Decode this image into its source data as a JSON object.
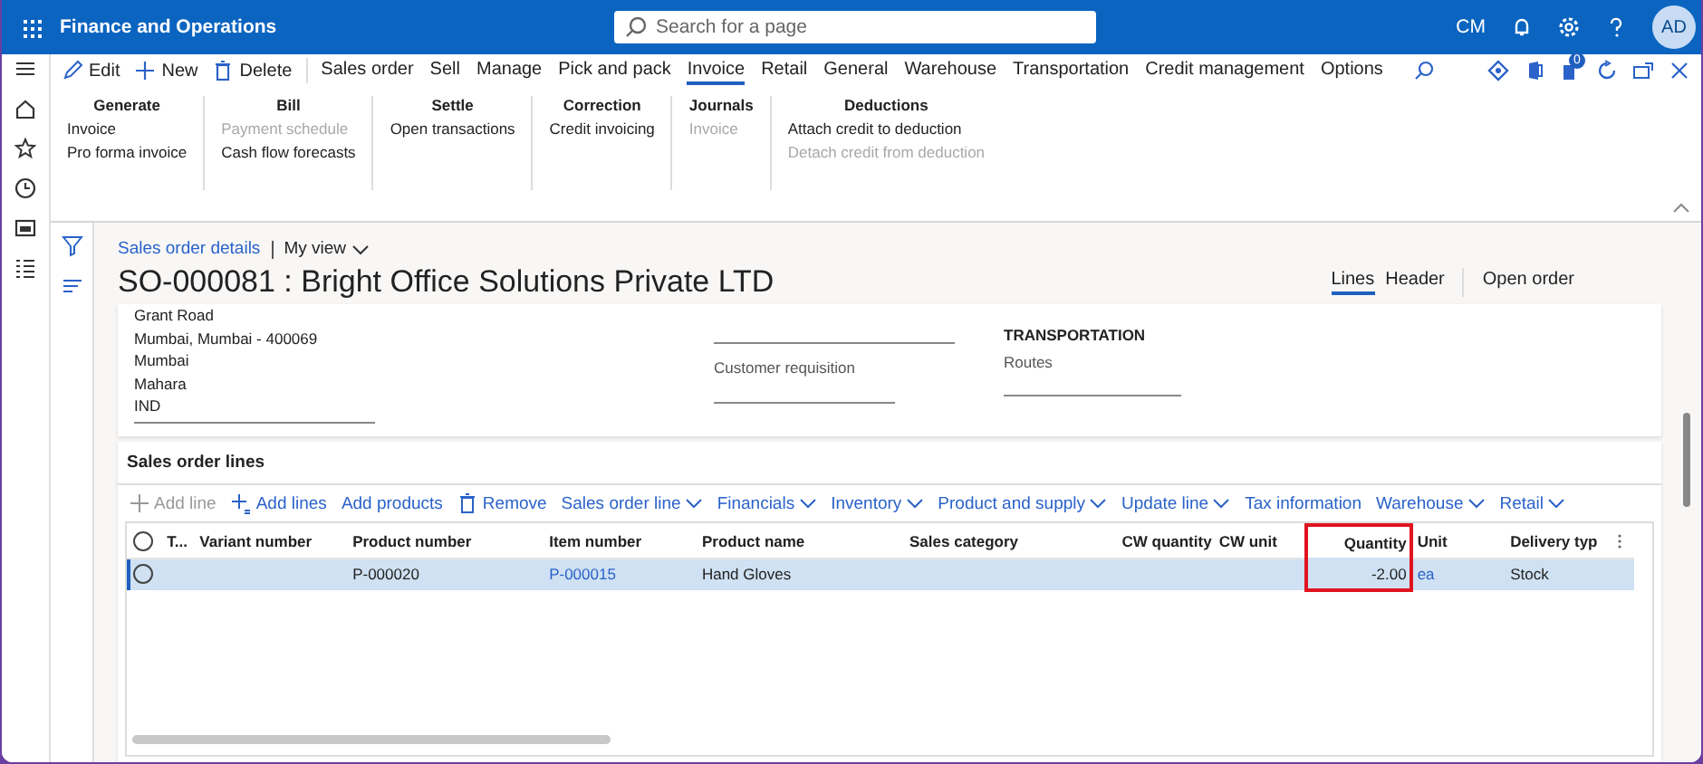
{
  "app_bar": {
    "title": "Finance and Operations",
    "search": {
      "placeholder": "Search for a page"
    },
    "company": "CM",
    "avatar": "AD"
  },
  "action_pane": {
    "buttons": [
      {
        "label": "Edit",
        "kind": "edit"
      },
      {
        "label": "New",
        "kind": "new"
      },
      {
        "label": "Delete",
        "kind": "delete"
      }
    ],
    "tabs": [
      {
        "label": "Sales order",
        "selected": false
      },
      {
        "label": "Sell",
        "selected": false
      },
      {
        "label": "Manage",
        "selected": false
      },
      {
        "label": "Pick and pack",
        "selected": false
      },
      {
        "label": "Invoice",
        "selected": true
      },
      {
        "label": "Retail",
        "selected": false
      },
      {
        "label": "General",
        "selected": false
      },
      {
        "label": "Warehouse",
        "selected": false
      },
      {
        "label": "Transportation",
        "selected": false
      },
      {
        "label": "Credit management",
        "selected": false
      },
      {
        "label": "Options",
        "selected": false
      }
    ],
    "badge_count": "0"
  },
  "ribbon": {
    "groups": [
      {
        "title": "Generate",
        "items": [
          {
            "label": "Invoice",
            "disabled": false
          },
          {
            "label": "Pro forma invoice",
            "disabled": false
          }
        ]
      },
      {
        "title": "Bill",
        "items": [
          {
            "label": "Payment schedule",
            "disabled": true
          },
          {
            "label": "Cash flow forecasts",
            "disabled": false
          }
        ]
      },
      {
        "title": "Settle",
        "items": [
          {
            "label": "Open transactions",
            "disabled": false
          }
        ]
      },
      {
        "title": "Correction",
        "items": [
          {
            "label": "Credit invoicing",
            "disabled": false
          }
        ]
      },
      {
        "title": "Journals",
        "items": [
          {
            "label": "Invoice",
            "disabled": true
          }
        ]
      },
      {
        "title": "Deductions",
        "items": [
          {
            "label": "Attach credit to deduction",
            "disabled": false
          },
          {
            "label": "Detach credit from deduction",
            "disabled": true
          }
        ]
      }
    ]
  },
  "page": {
    "breadcrumb": "Sales order details",
    "view": "My view",
    "title": "SO-000081 : Bright Office Solutions Private LTD",
    "view_tabs": [
      {
        "label": "Lines",
        "selected": true
      },
      {
        "label": "Header",
        "selected": false
      }
    ],
    "open_order": "Open order"
  },
  "header_card": {
    "address_lines": [
      "Grant Road",
      "Mumbai, Mumbai - 400069",
      "Mumbai",
      "Mahara",
      "IND"
    ],
    "customer_requisition": "Customer requisition",
    "transportation_heading": "TRANSPORTATION",
    "routes": "Routes"
  },
  "lines": {
    "title": "Sales order lines",
    "toolbar": [
      {
        "label": "Add line",
        "kind": "add",
        "disabled": true
      },
      {
        "label": "Add lines",
        "kind": "add_lines",
        "disabled": false
      },
      {
        "label": "Add products",
        "kind": "plain",
        "disabled": false
      },
      {
        "label": "Remove",
        "kind": "remove",
        "disabled": false
      },
      {
        "label": "Sales order line",
        "kind": "menu",
        "disabled": false
      },
      {
        "label": "Financials",
        "kind": "menu",
        "disabled": false
      },
      {
        "label": "Inventory",
        "kind": "menu",
        "disabled": false
      },
      {
        "label": "Product and supply",
        "kind": "menu",
        "disabled": false
      },
      {
        "label": "Update line",
        "kind": "menu",
        "disabled": false
      },
      {
        "label": "Tax information",
        "kind": "plain",
        "disabled": false
      },
      {
        "label": "Warehouse",
        "kind": "menu",
        "disabled": false
      },
      {
        "label": "Retail",
        "kind": "menu",
        "disabled": false
      }
    ],
    "columns": [
      {
        "label": "T...",
        "highlighted": false
      },
      {
        "label": "Variant number",
        "highlighted": false
      },
      {
        "label": "Product number",
        "highlighted": false
      },
      {
        "label": "Item number",
        "highlighted": false
      },
      {
        "label": "Product name",
        "highlighted": false
      },
      {
        "label": "Sales category",
        "highlighted": false
      },
      {
        "label": "CW quantity",
        "highlighted": false
      },
      {
        "label": "CW unit",
        "highlighted": false
      },
      {
        "label": "Quantity",
        "highlighted": true
      },
      {
        "label": "Unit",
        "highlighted": false
      },
      {
        "label": "Delivery typ",
        "highlighted": false
      }
    ],
    "rows": [
      {
        "selected": true,
        "cells": [
          null,
          null,
          {
            "text": "P-000020",
            "link": false
          },
          {
            "text": "P-000015",
            "link": true
          },
          {
            "text": "Hand Gloves",
            "link": false
          },
          null,
          null,
          null,
          {
            "text": "-2.00",
            "link": false
          },
          {
            "text": "ea",
            "link": true
          },
          {
            "text": "Stock",
            "link": false
          }
        ]
      }
    ]
  }
}
